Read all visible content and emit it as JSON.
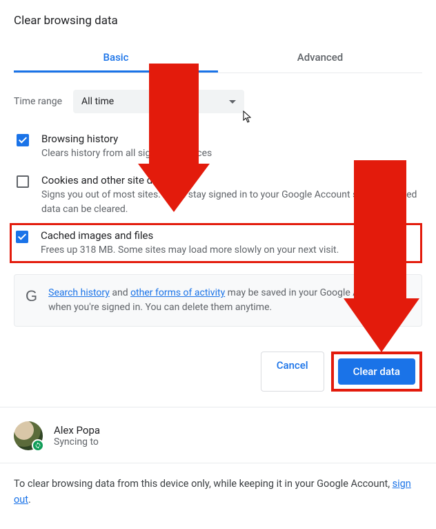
{
  "title": "Clear browsing data",
  "tabs": {
    "basic": "Basic",
    "advanced": "Advanced"
  },
  "timerange": {
    "label": "Time range",
    "value": "All time"
  },
  "options": {
    "history": {
      "title": "Browsing history",
      "desc": "Clears history from all signed-in devices"
    },
    "cookies": {
      "title": "Cookies and other site data",
      "desc": "Signs you out of most sites. You'll stay signed in to your Google Account so your synced data can be cleared."
    },
    "cache": {
      "title": "Cached images and files",
      "desc": "Frees up 318 MB. Some sites may load more slowly on your next visit."
    }
  },
  "info": {
    "link1": "Search history",
    "mid1": " and ",
    "link2": "other forms of activity",
    "rest": " may be saved in your Google Account when you're signed in. You can delete them anytime."
  },
  "buttons": {
    "cancel": "Cancel",
    "clear": "Clear data"
  },
  "account": {
    "name": "Alex Popa",
    "sync": "Syncing to"
  },
  "footer": {
    "text1": "To clear browsing data from this device only, while keeping it in your Google Account, ",
    "signout": "sign out",
    "text2": "."
  }
}
